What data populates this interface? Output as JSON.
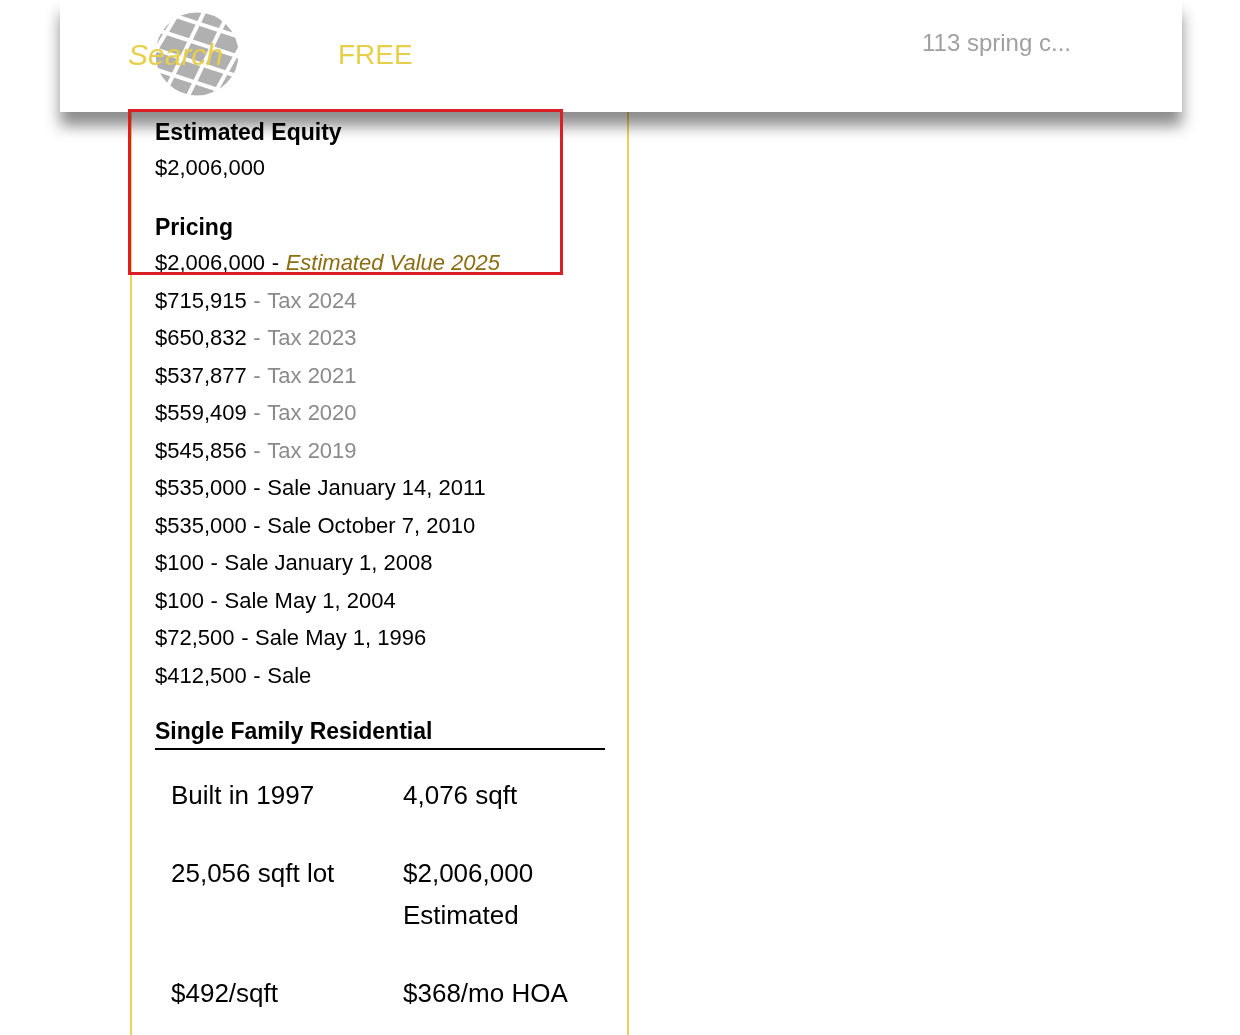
{
  "header": {
    "search_label": "Search",
    "free_label": "FREE",
    "address": "113 spring c..."
  },
  "equity": {
    "heading": "Estimated Equity",
    "value": "$2,006,000"
  },
  "pricing": {
    "heading": "Pricing",
    "highlighted": true,
    "rows": [
      {
        "kind": "estimate",
        "amount": "$2,006,000",
        "separator": "-",
        "label": "Estimated Value 2025"
      },
      {
        "kind": "tax",
        "amount": "$715,915",
        "separator": "-",
        "label": "Tax 2024"
      },
      {
        "kind": "tax",
        "amount": "$650,832",
        "separator": "-",
        "label": "Tax 2023"
      },
      {
        "kind": "tax",
        "amount": "$537,877",
        "separator": "-",
        "label": "Tax 2021"
      },
      {
        "kind": "tax",
        "amount": "$559,409",
        "separator": "-",
        "label": "Tax 2020"
      },
      {
        "kind": "tax",
        "amount": "$545,856",
        "separator": "-",
        "label": "Tax 2019"
      },
      {
        "kind": "sale",
        "amount": "$535,000",
        "separator": "-",
        "label": "Sale January 14, 2011"
      },
      {
        "kind": "sale",
        "amount": "$535,000",
        "separator": "-",
        "label": "Sale October 7, 2010"
      },
      {
        "kind": "sale",
        "amount": "$100",
        "separator": "-",
        "label": "Sale January 1, 2008"
      },
      {
        "kind": "sale",
        "amount": "$100",
        "separator": "-",
        "label": "Sale May 1, 2004"
      },
      {
        "kind": "sale",
        "amount": "$72,500",
        "separator": "-",
        "label": "Sale May 1, 1996"
      },
      {
        "kind": "sale",
        "amount": "$412,500",
        "separator": "-",
        "label": "Sale"
      }
    ]
  },
  "property": {
    "heading": "Single Family Residential",
    "facts": [
      [
        "Built in 1997"
      ],
      [
        "4,076 sqft"
      ],
      [
        "25,056 sqft lot"
      ],
      [
        "$2,006,000",
        "Estimated"
      ],
      [
        "$492/sqft"
      ],
      [
        "$368/mo HOA"
      ]
    ]
  }
}
